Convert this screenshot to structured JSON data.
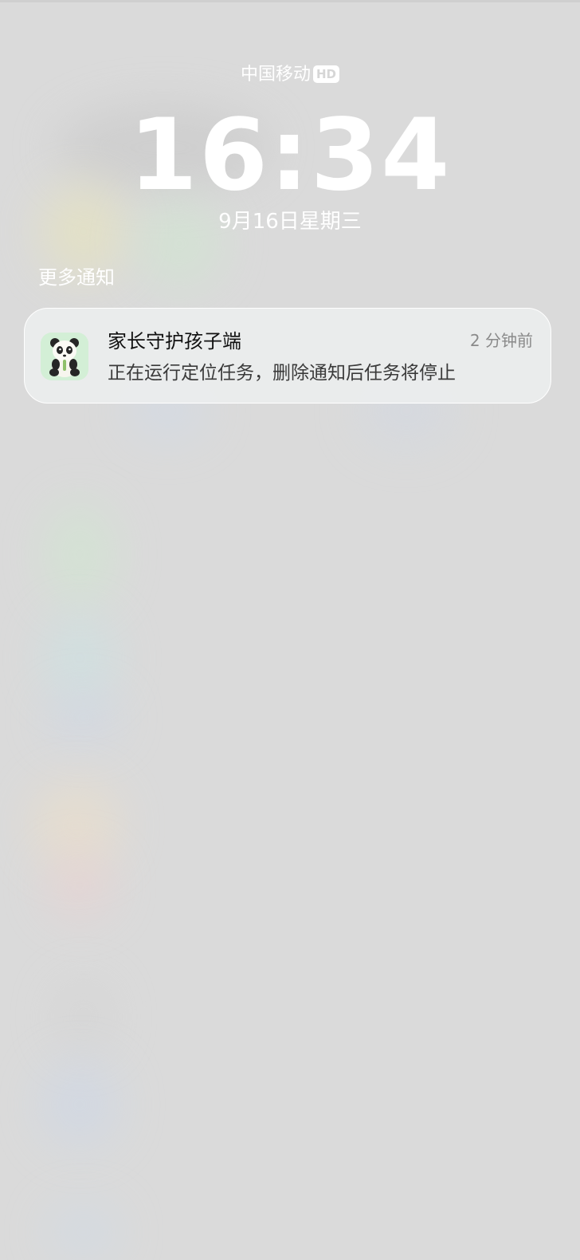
{
  "status": {
    "carrier": "中国移动",
    "network_badge": "HD"
  },
  "lockscreen": {
    "time": "16:34",
    "date": "9月16日星期三"
  },
  "notifications": {
    "section_label": "更多通知",
    "items": [
      {
        "app_name": "家长守护孩子端",
        "time_ago": "2 分钟前",
        "message": "正在运行定位任务，删除通知后任务将停止",
        "icon": "panda-app-icon"
      }
    ]
  },
  "colors": {
    "background": "#dadada",
    "text_primary": "#ffffff",
    "card_background": "#eceeee",
    "app_icon_background": "#d3efd6"
  }
}
